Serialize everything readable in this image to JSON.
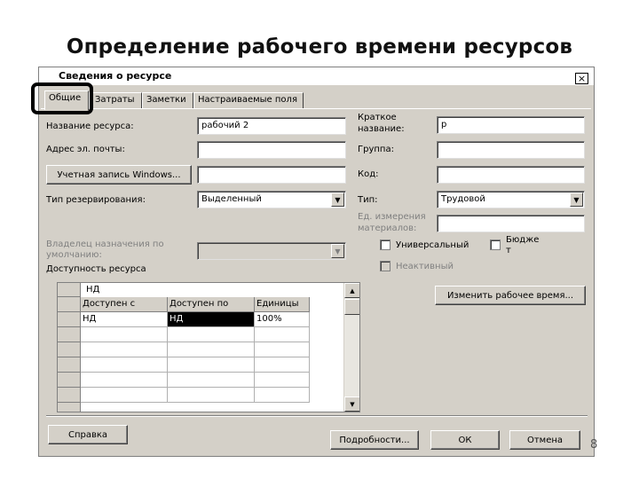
{
  "slide": {
    "title": "Определение рабочего времени ресурсов",
    "page_number": "8"
  },
  "dialog": {
    "title": "Сведения о ресурсе",
    "close_label": "×",
    "tabs": [
      {
        "label": "Общие",
        "active": true
      },
      {
        "label": "Затраты",
        "active": false
      },
      {
        "label": "Заметки",
        "active": false
      },
      {
        "label": "Настраиваемые поля",
        "active": false
      }
    ],
    "left": {
      "name_label": "Название ресурса:",
      "name_value": "рабочий 2",
      "email_label": "Адрес эл. почты:",
      "email_value": "",
      "windows_button": "Учетная запись Windows...",
      "windows_value": "",
      "booking_label": "Тип резервирования:",
      "booking_value": "Выделенный",
      "owner_label_1": "Владелец назначения по",
      "owner_label_2": "умолчанию:",
      "owner_value": "",
      "availability_label": "Доступность ресурса"
    },
    "right": {
      "short_name_label_1": "Краткое",
      "short_name_label_2": "название:",
      "short_name_value": "р",
      "group_label": "Группа:",
      "group_value": "",
      "code_label": "Код:",
      "code_value": "",
      "type_label": "Тип:",
      "type_value": "Трудовой",
      "units_label_1": "Ед. измерения",
      "units_label_2": "материалов:",
      "units_value": "",
      "generic_label": "Универсальный",
      "budget_label_1": "Бюдже",
      "budget_label_2": "т",
      "inactive_label": "Неактивный",
      "change_time_button": "Изменить рабочее время..."
    },
    "grid": {
      "edit_value": "НД",
      "columns": [
        "Доступен с",
        "Доступен по",
        "Единицы"
      ],
      "rows": [
        [
          "НД",
          "НД",
          "100%"
        ],
        [
          "",
          "",
          ""
        ],
        [
          "",
          "",
          ""
        ],
        [
          "",
          "",
          ""
        ],
        [
          "",
          "",
          ""
        ],
        [
          "",
          "",
          ""
        ]
      ]
    },
    "buttons": {
      "help": "Справка",
      "details": "Подробности...",
      "ok": "ОК",
      "cancel": "Отмена"
    },
    "icons": {
      "close": "close-icon",
      "dropdown": "chevron-down-icon",
      "scroll_up": "arrow-up-icon",
      "scroll_down": "arrow-down-icon"
    }
  }
}
